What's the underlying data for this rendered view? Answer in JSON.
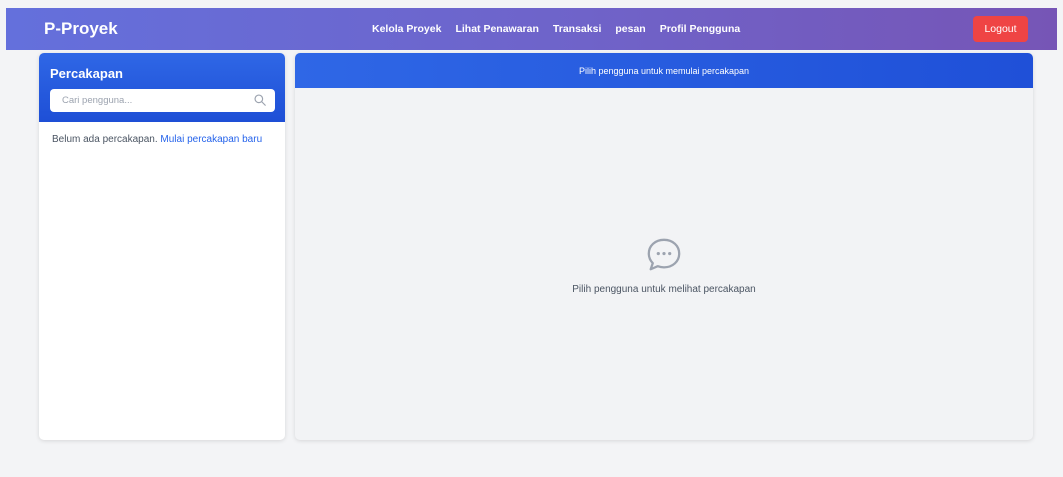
{
  "navbar": {
    "brand": "P-Proyek",
    "links": [
      "Kelola Proyek",
      "Lihat Penawaran",
      "Transaksi",
      "pesan",
      "Profil Pengguna"
    ],
    "logout_label": "Logout"
  },
  "sidebar": {
    "title": "Percakapan",
    "search_placeholder": "Cari pengguna...",
    "empty_text": "Belum ada percakapan.",
    "empty_link": "Mulai percakapan baru"
  },
  "main": {
    "header_text": "Pilih pengguna untuk memulai percakapan",
    "placeholder_text": "Pilih pengguna untuk melihat percakapan"
  },
  "colors": {
    "navbar_start": "#6470dc",
    "navbar_end": "#7655b6",
    "accent_blue": "#2563eb",
    "logout_red": "#ef4444"
  },
  "icons": {
    "search": "search-icon",
    "chat": "chat-bubble-icon"
  }
}
